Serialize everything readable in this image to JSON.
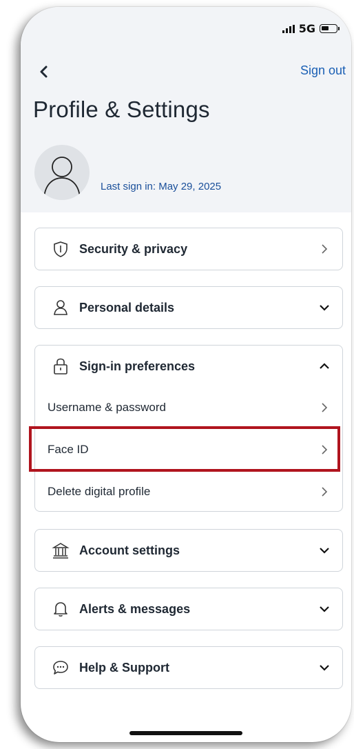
{
  "status_bar": {
    "network": "5G"
  },
  "nav": {
    "back_icon": "chevron-left-icon",
    "sign_out": "Sign out"
  },
  "page": {
    "title": "Profile & Settings",
    "last_sign_in": "Last sign in: May 29, 2025",
    "avatar_icon": "user-avatar-icon"
  },
  "sections": [
    {
      "label": "Security & privacy",
      "icon": "shield-icon",
      "chevron": "right"
    },
    {
      "label": "Personal details",
      "icon": "person-icon",
      "chevron": "down"
    },
    {
      "label": "Sign-in preferences",
      "icon": "lock-icon",
      "chevron": "up",
      "items": [
        {
          "label": "Username & password"
        },
        {
          "label": "Face ID",
          "highlighted": true
        },
        {
          "label": "Delete digital profile"
        }
      ]
    },
    {
      "label": "Account settings",
      "icon": "bank-icon",
      "chevron": "down"
    },
    {
      "label": "Alerts & messages",
      "icon": "bell-icon",
      "chevron": "down"
    },
    {
      "label": "Help & Support",
      "icon": "chat-icon",
      "chevron": "down"
    }
  ],
  "colors": {
    "link": "#1a5fb4",
    "highlight": "#b0141e",
    "header_bg": "#f2f4f7"
  }
}
